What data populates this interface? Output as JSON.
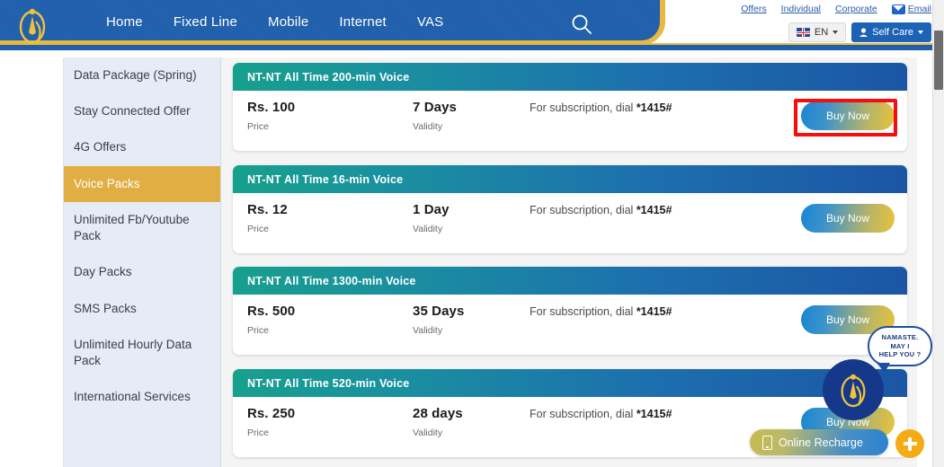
{
  "header": {
    "logo_name": "ntc-namaste-logo",
    "nav": [
      {
        "label": "Home"
      },
      {
        "label": "Fixed Line"
      },
      {
        "label": "Mobile"
      },
      {
        "label": "Internet"
      },
      {
        "label": "VAS"
      }
    ],
    "search_icon": "search-icon",
    "util_links": [
      {
        "label": "Offers"
      },
      {
        "label": "Individual"
      },
      {
        "label": "Corporate"
      },
      {
        "label": "Email",
        "icon": "envelope-icon"
      }
    ],
    "language": {
      "label": "EN",
      "icon": "uk-flag-icon"
    },
    "self_care": {
      "label": "Self Care",
      "icon": "user-icon"
    }
  },
  "sidebar": {
    "items": [
      {
        "label": "Data Package (Spring)",
        "active": false
      },
      {
        "label": "Stay Connected Offer",
        "active": false
      },
      {
        "label": "4G Offers",
        "active": false
      },
      {
        "label": "Voice Packs",
        "active": true
      },
      {
        "label": "Unlimited Fb/Youtube Pack",
        "active": false
      },
      {
        "label": "Day Packs",
        "active": false
      },
      {
        "label": "SMS Packs",
        "active": false
      },
      {
        "label": "Unlimited Hourly Data Pack",
        "active": false
      },
      {
        "label": "International Services",
        "active": false
      }
    ]
  },
  "labels": {
    "price_label": "Price",
    "validity_label": "Validity",
    "buy_now": "Buy Now"
  },
  "cards": [
    {
      "title": "NT-NT All Time 200-min Voice",
      "price": "Rs. 100",
      "price_label": "Price",
      "validity": "7 Days",
      "validity_label": "Validity",
      "dial_prefix": "For subscription, dial ",
      "dial_code": "*1415#",
      "buy_label": "Buy Now",
      "highlighted": true
    },
    {
      "title": "NT-NT All Time 16-min Voice",
      "price": "Rs. 12",
      "price_label": "Price",
      "validity": "1 Day",
      "validity_label": "Validity",
      "dial_prefix": "For subscription, dial ",
      "dial_code": "*1415#",
      "buy_label": "Buy Now",
      "highlighted": false
    },
    {
      "title": "NT-NT All Time 1300-min Voice",
      "price": "Rs. 500",
      "price_label": "Price",
      "validity": "35 Days",
      "validity_label": "Validity",
      "dial_prefix": "For subscription, dial ",
      "dial_code": "*1415#",
      "buy_label": "Buy Now",
      "highlighted": false
    },
    {
      "title": "NT-NT All Time 520-min Voice",
      "price": "Rs. 250",
      "price_label": "Price",
      "validity": "28 days",
      "validity_label": "Validity",
      "dial_prefix": "For subscription, dial ",
      "dial_code": "*1415#",
      "buy_label": "Buy Now",
      "highlighted": false
    }
  ],
  "widgets": {
    "chat_bubble_line1": "NAMASTE.",
    "chat_bubble_line2": "MAY I",
    "chat_bubble_line3": "HELP YOU ?",
    "chat_avatar_name": "namaste-assistant-avatar",
    "recharge_label": "Online Recharge",
    "fab_label": "+"
  },
  "colors": {
    "nav_blue": "#1f5fab",
    "gold": "#e8b93d",
    "active_side": "#e0ae42",
    "card_head_start": "#17a08d",
    "card_head_end": "#1b56a4",
    "highlight_red": "#f60d0d",
    "fab_orange": "#f5ab15"
  }
}
